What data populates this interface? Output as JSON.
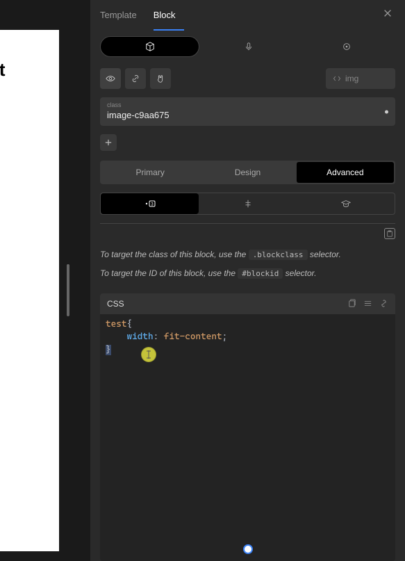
{
  "left": {
    "text": "akt"
  },
  "tabs": {
    "template_label": "Template",
    "block_label": "Block"
  },
  "class_field": {
    "label": "class",
    "value": "image-c9aa675"
  },
  "img_chip": {
    "label": "img"
  },
  "section_tabs": {
    "primary": "Primary",
    "design": "Design",
    "advanced": "Advanced"
  },
  "help": {
    "class_prefix": "To target the class of this block, use the ",
    "class_code": ".blockclass",
    "class_suffix": " selector.",
    "id_prefix": "To target the ID of this block, use the ",
    "id_code": "#blockid",
    "id_suffix": " selector."
  },
  "editor": {
    "title": "CSS",
    "code": {
      "selector": "test",
      "open_brace": "{",
      "prop": "width",
      "colon": ": ",
      "value": "fit-content",
      "semicolon": ";",
      "close_brace": "}"
    }
  }
}
